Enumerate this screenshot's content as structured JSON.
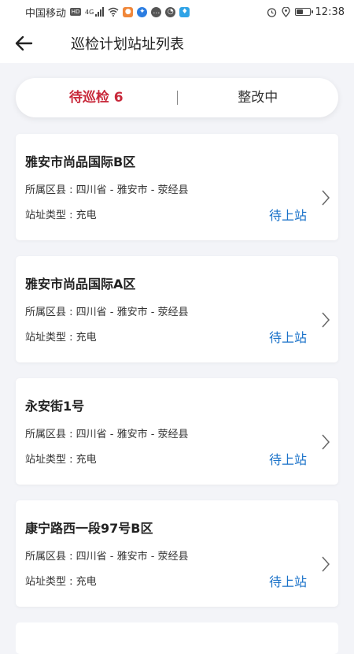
{
  "status_bar": {
    "carrier": "中国移动",
    "hd_label": "HD",
    "network": "4G",
    "time": "12:38",
    "battery_level": 0.5
  },
  "header": {
    "back_icon": "arrow-left-icon",
    "title": "巡检计划站址列表"
  },
  "tabs": [
    {
      "label": "待巡检 6",
      "active": true
    },
    {
      "label": "整改中",
      "active": false
    }
  ],
  "colors": {
    "active_tab": "#c8283a",
    "status_link": "#1a72c9",
    "background": "#f3f4f8"
  },
  "cards": [
    {
      "title": "雅安市尚品国际B区",
      "region": "所属区县 : 四川省 - 雅安市 - 荥经县",
      "type": "站址类型 : 充电",
      "status": "待上站"
    },
    {
      "title": "雅安市尚品国际A区",
      "region": "所属区县 : 四川省 - 雅安市 - 荥经县",
      "type": "站址类型 : 充电",
      "status": "待上站"
    },
    {
      "title": "永安街1号",
      "region": "所属区县 : 四川省 - 雅安市 - 荥经县",
      "type": "站址类型 : 充电",
      "status": "待上站"
    },
    {
      "title": "康宁路西一段97号B区",
      "region": "所属区县 : 四川省 - 雅安市 - 荥经县",
      "type": "站址类型 : 充电",
      "status": "待上站"
    }
  ]
}
